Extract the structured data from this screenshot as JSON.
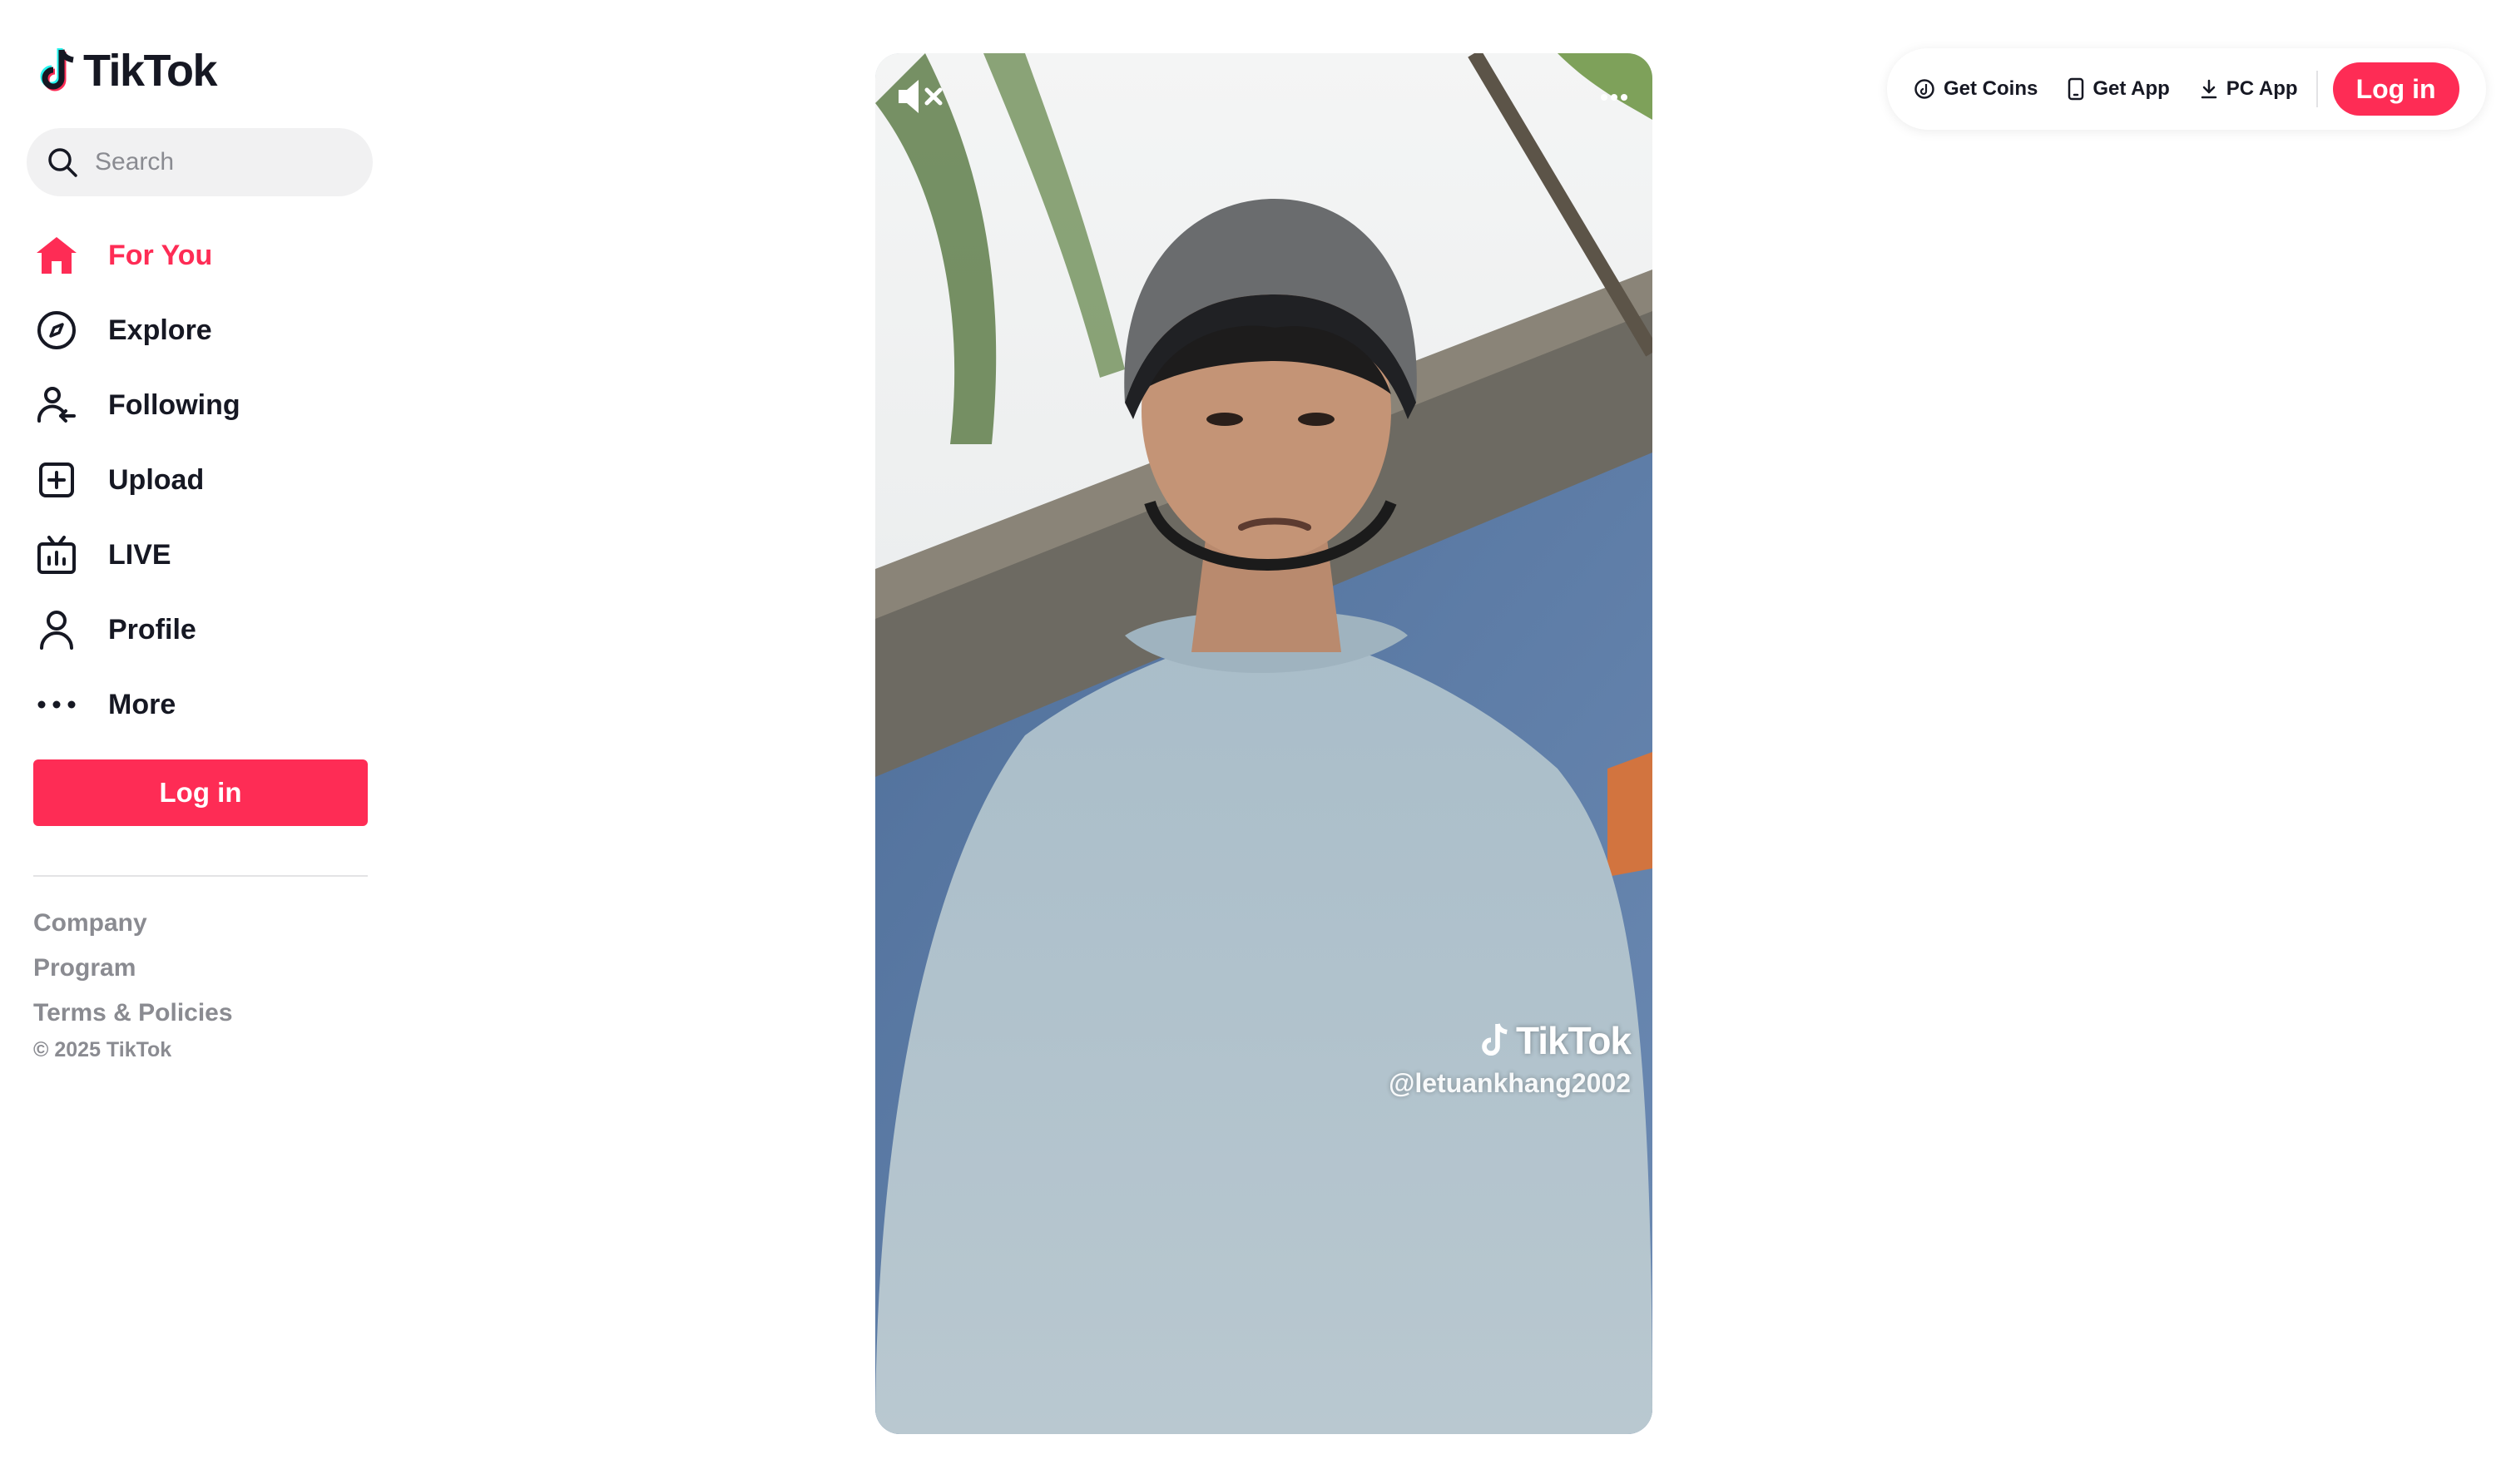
{
  "logo": {
    "text": "TikTok"
  },
  "search": {
    "placeholder": "Search"
  },
  "nav": [
    {
      "label": "For You",
      "icon": "home-icon",
      "active": true
    },
    {
      "label": "Explore",
      "icon": "compass-icon"
    },
    {
      "label": "Following",
      "icon": "following-icon"
    },
    {
      "label": "Upload",
      "icon": "upload-icon"
    },
    {
      "label": "LIVE",
      "icon": "live-icon"
    },
    {
      "label": "Profile",
      "icon": "profile-icon"
    },
    {
      "label": "More",
      "icon": "more-icon"
    }
  ],
  "sidebar_login": "Log in",
  "footer": {
    "links": [
      "Company",
      "Program",
      "Terms & Policies"
    ],
    "copyright": "© 2025 TikTok"
  },
  "video": {
    "watermark_brand": "TikTok",
    "watermark_user": "@letuankhang2002"
  },
  "topbar": {
    "get_coins": "Get Coins",
    "get_app": "Get App",
    "pc_app": "PC App",
    "login": "Log in"
  },
  "colors": {
    "accent": "#fe2c55",
    "text": "#161823",
    "muted": "#8a8b91"
  }
}
